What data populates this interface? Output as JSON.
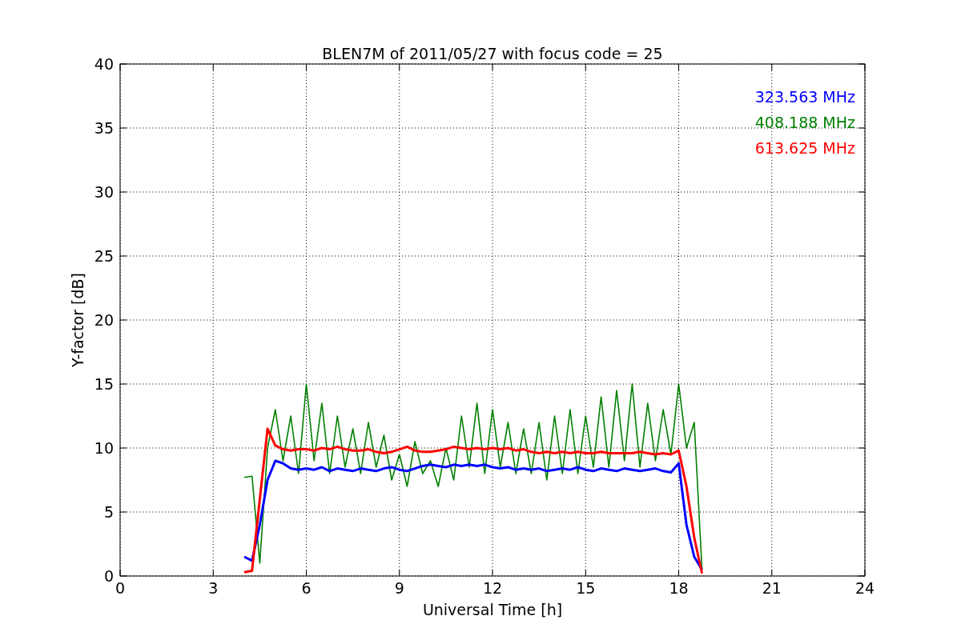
{
  "chart_data": {
    "type": "line",
    "title": "BLEN7M of 2011/05/27 with focus code = 25",
    "xlabel": "Universal Time [h]",
    "ylabel": "Y-factor [dB]",
    "x": [
      4,
      4.25,
      4.5,
      4.75,
      5,
      5.25,
      5.5,
      5.75,
      6,
      6.25,
      6.5,
      6.75,
      7,
      7.25,
      7.5,
      7.75,
      8,
      8.25,
      8.5,
      8.75,
      9,
      9.25,
      9.5,
      9.75,
      10,
      10.25,
      10.5,
      10.75,
      11,
      11.25,
      11.5,
      11.75,
      12,
      12.25,
      12.5,
      12.75,
      13,
      13.25,
      13.5,
      13.75,
      14,
      14.25,
      14.5,
      14.75,
      15,
      15.25,
      15.5,
      15.75,
      16,
      16.25,
      16.5,
      16.75,
      17,
      17.25,
      17.5,
      17.75,
      18,
      18.25,
      18.5,
      18.75
    ],
    "series": [
      {
        "name": "323.563 MHz",
        "color": "#0000ff",
        "values": [
          1.5,
          1.2,
          4.0,
          7.5,
          9.0,
          8.8,
          8.4,
          8.3,
          8.4,
          8.3,
          8.5,
          8.2,
          8.4,
          8.3,
          8.2,
          8.4,
          8.3,
          8.2,
          8.4,
          8.5,
          8.3,
          8.2,
          8.4,
          8.6,
          8.7,
          8.6,
          8.5,
          8.7,
          8.6,
          8.7,
          8.6,
          8.7,
          8.5,
          8.4,
          8.5,
          8.3,
          8.4,
          8.3,
          8.4,
          8.2,
          8.3,
          8.4,
          8.3,
          8.5,
          8.3,
          8.2,
          8.4,
          8.3,
          8.2,
          8.4,
          8.3,
          8.2,
          8.3,
          8.4,
          8.2,
          8.1,
          8.8,
          4.0,
          1.5,
          0.5
        ]
      },
      {
        "name": "408.188 MHz",
        "color": "#008000",
        "values": [
          7.7,
          7.8,
          1.0,
          10.0,
          13.0,
          9.0,
          12.5,
          8.0,
          15.0,
          9.0,
          13.5,
          8.0,
          12.5,
          8.5,
          11.5,
          8.0,
          12.0,
          8.5,
          11.0,
          7.5,
          9.5,
          7.0,
          10.5,
          8.0,
          9.0,
          7.0,
          10.0,
          7.5,
          12.5,
          8.5,
          13.5,
          8.0,
          13.0,
          8.5,
          12.0,
          8.0,
          11.5,
          8.0,
          12.0,
          7.5,
          12.5,
          8.0,
          13.0,
          8.0,
          12.5,
          8.5,
          14.0,
          8.5,
          14.5,
          9.0,
          15.0,
          8.5,
          13.5,
          9.0,
          13.0,
          9.5,
          15.0,
          10.0,
          12.0,
          0.5
        ]
      },
      {
        "name": "613.625 MHz",
        "color": "#ff0000",
        "values": [
          0.3,
          0.4,
          6.0,
          11.5,
          10.2,
          9.9,
          9.8,
          9.9,
          9.9,
          9.8,
          10.0,
          9.9,
          10.1,
          9.9,
          9.8,
          9.8,
          9.9,
          9.7,
          9.6,
          9.7,
          9.9,
          10.1,
          9.8,
          9.7,
          9.7,
          9.8,
          9.9,
          10.1,
          10.0,
          9.9,
          10.0,
          9.9,
          10.0,
          9.9,
          10.0,
          9.8,
          9.9,
          9.7,
          9.6,
          9.7,
          9.6,
          9.7,
          9.6,
          9.7,
          9.6,
          9.6,
          9.7,
          9.6,
          9.6,
          9.6,
          9.6,
          9.7,
          9.6,
          9.5,
          9.6,
          9.5,
          9.8,
          7.0,
          3.0,
          0.2
        ]
      }
    ],
    "grid": true,
    "xlim": [
      0,
      24
    ],
    "ylim": [
      0,
      40
    ],
    "xticks": [
      0,
      3,
      6,
      9,
      12,
      15,
      18,
      21,
      24
    ],
    "yticks": [
      0,
      5,
      10,
      15,
      20,
      25,
      30,
      35,
      40
    ]
  }
}
